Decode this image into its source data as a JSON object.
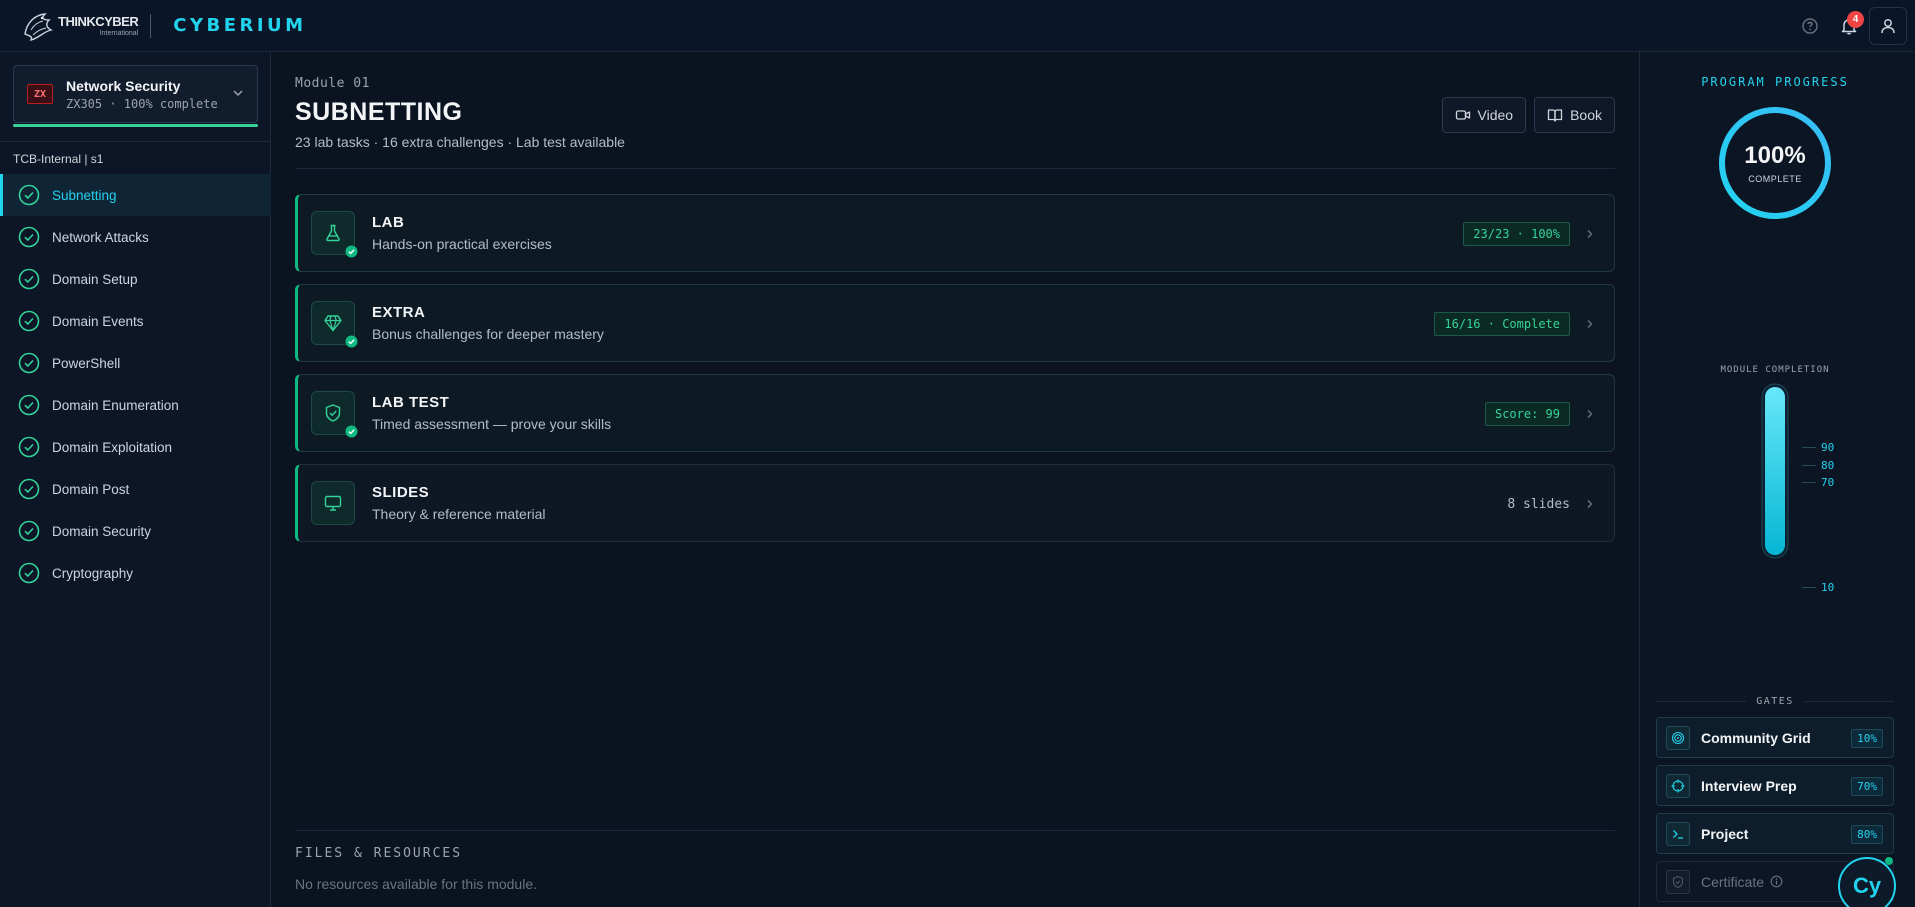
{
  "brand": {
    "name": "THINKCYBER",
    "sub": "International",
    "product": "CYBERIUM"
  },
  "topbar": {
    "notification_count": "4"
  },
  "sidebar": {
    "course": {
      "badge": "ZX",
      "title": "Network Security",
      "subtitle": "ZX305 · 100% complete"
    },
    "org_label": "TCB-Internal | s1",
    "items": [
      {
        "label": "Subnetting",
        "active": true
      },
      {
        "label": "Network Attacks"
      },
      {
        "label": "Domain Setup"
      },
      {
        "label": "Domain Events"
      },
      {
        "label": "PowerShell"
      },
      {
        "label": "Domain Enumeration"
      },
      {
        "label": "Domain Exploitation"
      },
      {
        "label": "Domain Post"
      },
      {
        "label": "Domain Security"
      },
      {
        "label": "Cryptography"
      }
    ]
  },
  "main": {
    "module_label": "Module 01",
    "title": "SUBNETTING",
    "subtitle": "23 lab tasks · 16 extra challenges · Lab test available",
    "buttons": {
      "video": "Video",
      "book": "Book"
    },
    "cards": [
      {
        "title": "LAB",
        "desc": "Hands-on practical exercises",
        "meta": "23/23 · 100%",
        "icon": "flask-icon"
      },
      {
        "title": "EXTRA",
        "desc": "Bonus challenges for deeper mastery",
        "meta": "16/16 · Complete",
        "icon": "gem-icon"
      },
      {
        "title": "LAB TEST",
        "desc": "Timed assessment — prove your skills",
        "meta": "Score: 99",
        "icon": "shield-check-icon"
      },
      {
        "title": "SLIDES",
        "desc": "Theory & reference material",
        "meta": "8 slides",
        "icon": "monitor-icon"
      }
    ],
    "files": {
      "title": "FILES & RESOURCES",
      "empty": "No resources available for this module."
    }
  },
  "right_panel": {
    "program_progress_title": "PROGRAM PROGRESS",
    "progress_value": "100%",
    "progress_label": "COMPLETE",
    "progress_fraction": 1.0,
    "module_completion_title": "MODULE COMPLETION",
    "module_completion_fraction": 1.0,
    "ticks": [
      "90",
      "80",
      "70",
      "10"
    ],
    "gates_title": "GATES",
    "gates": [
      {
        "name": "Community Grid",
        "pct": "10%",
        "icon": "fingerprint-icon"
      },
      {
        "name": "Interview Prep",
        "pct": "70%",
        "icon": "target-icon"
      },
      {
        "name": "Project",
        "pct": "80%",
        "icon": "terminal-icon"
      },
      {
        "name": "Certificate",
        "pct": "",
        "icon": "shield-icon",
        "locked": true
      }
    ],
    "assistant_label": "Cy"
  },
  "colors": {
    "accent": "#22d3ee",
    "success": "#10b981",
    "danger": "#ef4444",
    "background": "#0b1220"
  }
}
